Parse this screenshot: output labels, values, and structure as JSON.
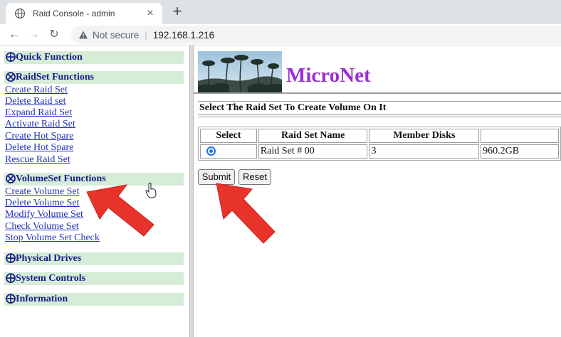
{
  "browser": {
    "tab_title": "Raid Console - admin",
    "tab_close": "×",
    "new_tab": "+",
    "not_secure": "Not secure",
    "url": "192.168.1.216",
    "url_separator": "|",
    "nav": {
      "back": "←",
      "forward": "→",
      "reload": "↻"
    }
  },
  "sidebar": {
    "sections": [
      {
        "symbol": "⨁",
        "title": "Quick Function",
        "items": []
      },
      {
        "symbol": "⨂",
        "title": "RaidSet Functions",
        "items": [
          "Create Raid Set",
          "Delete Raid set",
          "Expand Raid Set",
          "Activate Raid Set",
          "Create Hot Spare",
          "Delete Hot Spare",
          "Rescue Raid Set"
        ]
      },
      {
        "symbol": "⨂",
        "title": "VolumeSet Functions",
        "items": [
          "Create Volume Set",
          "Delete Volume Set",
          "Modify Volume Set",
          "Check Volume Set",
          "Stop Volume Set Check"
        ]
      },
      {
        "symbol": "⨁",
        "title": "Physical Drives",
        "items": []
      },
      {
        "symbol": "⨁",
        "title": "System Controls",
        "items": []
      },
      {
        "symbol": "⨁",
        "title": "Information",
        "items": []
      }
    ]
  },
  "main": {
    "brand": "MicroNet",
    "section_title": "Select The Raid Set To Create Volume On It",
    "table": {
      "headers": [
        "Select",
        "Raid Set Name",
        "Member Disks",
        ""
      ],
      "rows": [
        {
          "selected": true,
          "name": "Raid Set # 00",
          "members": "3",
          "capacity": "960.2GB"
        }
      ]
    },
    "submit_label": "Submit",
    "reset_label": "Reset"
  },
  "colors": {
    "section_bg": "#d6ecd6",
    "section_text": "#16208a",
    "link": "#2432b8",
    "brand": "#9b2fd0",
    "arrow": "#e8332a"
  }
}
